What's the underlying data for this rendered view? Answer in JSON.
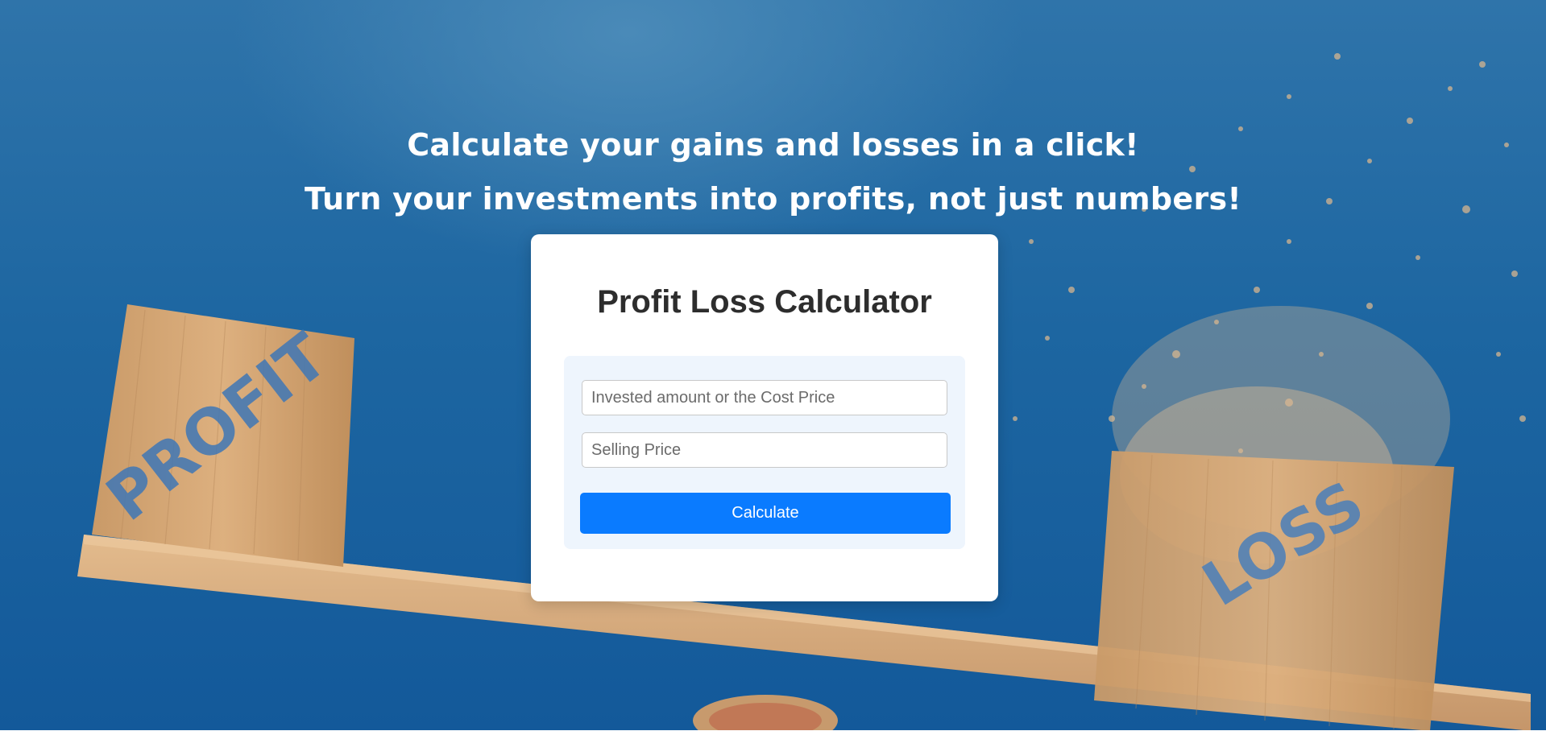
{
  "hero": {
    "line1": "Calculate your gains and losses in a click!",
    "line2": "Turn your investments into profits, not just numbers!",
    "block_left_label": "PROFIT",
    "block_right_label": "LOSS"
  },
  "calculator": {
    "title": "Profit Loss Calculator",
    "cost_price_placeholder": "Invested amount or the Cost Price",
    "selling_price_placeholder": "Selling Price",
    "button_label": "Calculate"
  },
  "colors": {
    "background_blue": "#1d66a1",
    "button_blue": "#0a7bff",
    "panel_bg": "#eef5fd"
  }
}
